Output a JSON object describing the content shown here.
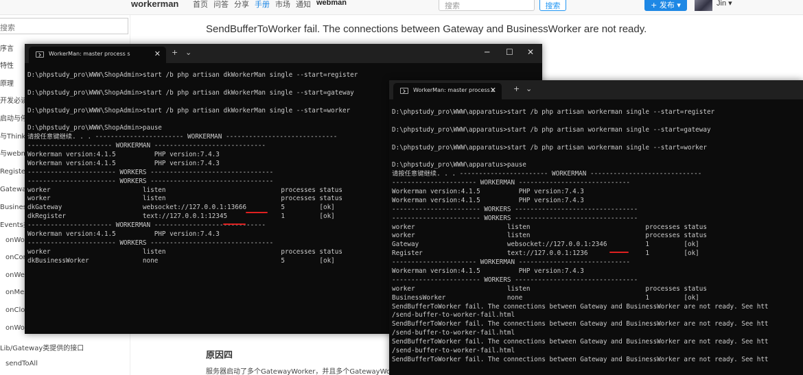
{
  "navbar": {
    "brand": "workerman",
    "links": [
      "首页",
      "问答",
      "分享",
      "手册",
      "市场",
      "通知",
      "webman"
    ],
    "search_placeholder": "搜索",
    "search_button": "搜索",
    "publish_button": "+ 发布 ▾",
    "username": "Jin ▾"
  },
  "sidebar": {
    "search_placeholder": "搜索",
    "items": [
      "序言",
      "特性",
      "原理",
      "开发必读",
      "启动与停止",
      "与ThinkPHP",
      "与webman",
      "Register类",
      "Gateway类",
      "BusinessWorker类",
      "Events类",
      "onWorkerStart",
      "onConnect",
      "onWebSocketConnect",
      "onMessage",
      "onClose",
      "onWorkerStop",
      "Lib/Gateway类提供的接口",
      "sendToAll"
    ]
  },
  "content": {
    "headline": "SendBufferToWorker fail. The connections between Gateway and BusinessWorker are not ready.",
    "sub_heading": "原因四",
    "paragraph": "服务器启动了多个GatewayWorker，并且多个GatewayWorker使用了相同的端口导致冲突，可以用命令 ps aux 查看进程数并测试"
  },
  "terminal_left": {
    "tab_title": "WorkerMan: master process  s",
    "lines": [
      "D:\\phpstudy_pro\\WWW\\ShopAdmin>start /b php artisan dkWorkerMan single --start=register",
      "",
      "D:\\phpstudy_pro\\WWW\\ShopAdmin>start /b php artisan dkWorkerMan single --start=gateway",
      "",
      "D:\\phpstudy_pro\\WWW\\ShopAdmin>start /b php artisan dkWorkerMan single --start=worker",
      "",
      "D:\\phpstudy_pro\\WWW\\ShopAdmin>pause",
      "请按任意键继续. . . ----------------------- WORKERMAN -----------------------------",
      "---------------------- WORKERMAN -----------------------------",
      "Workerman version:4.1.5          PHP version:7.4.3",
      "Workerman version:4.1.5          PHP version:7.4.3",
      "----------------------- WORKERS --------------------------------",
      "----------------------- WORKERS --------------------------------",
      "worker                        listen                              processes status",
      "worker                        listen                              processes status",
      "dkGateway                     websocket://127.0.0.1:13666         5         [ok]",
      "dkRegister                    text://127.0.0.1:12345              1         [ok]",
      "---------------------- WORKERMAN -----------------------------",
      "Workerman version:4.1.5          PHP version:7.4.3",
      "----------------------- WORKERS --------------------------------",
      "worker                        listen                              processes status",
      "dkBusinessWorker              none                                5         [ok]"
    ]
  },
  "terminal_right": {
    "tab_title": "WorkerMan: master process  s",
    "lines": [
      "D:\\phpstudy_pro\\WWW\\apparatus>start /b php artisan workerman single --start=register",
      "",
      "D:\\phpstudy_pro\\WWW\\apparatus>start /b php artisan workerman single --start=gateway",
      "",
      "D:\\phpstudy_pro\\WWW\\apparatus>start /b php artisan workerman single --start=worker",
      "",
      "D:\\phpstudy_pro\\WWW\\apparatus>pause",
      "请按任意键继续. . . ----------------------- WORKERMAN -----------------------------",
      "---------------------- WORKERMAN -----------------------------",
      "Workerman version:4.1.5          PHP version:7.4.3",
      "Workerman version:4.1.5          PHP version:7.4.3",
      "----------------------- WORKERS --------------------------------",
      "----------------------- WORKERS --------------------------------",
      "worker                        listen                              processes status",
      "worker                        listen                              processes status",
      "Gateway                       websocket://127.0.0.1:2346          1         [ok]",
      "Register                      text://127.0.0.1:1236               1         [ok]",
      "---------------------- WORKERMAN -----------------------------",
      "Workerman version:4.1.5          PHP version:7.4.3",
      "----------------------- WORKERS --------------------------------",
      "worker                        listen                              processes status",
      "BusinessWorker                none                                1         [ok]",
      "SendBufferToWorker fail. The connections between Gateway and BusinessWorker are not ready. See htt",
      "/send-buffer-to-worker-fail.html",
      "SendBufferToWorker fail. The connections between Gateway and BusinessWorker are not ready. See htt",
      "/send-buffer-to-worker-fail.html",
      "SendBufferToWorker fail. The connections between Gateway and BusinessWorker are not ready. See htt",
      "/send-buffer-to-worker-fail.html",
      "SendBufferToWorker fail. The connections between Gateway and BusinessWorker are not ready. See htt"
    ]
  },
  "colors": {
    "accent": "#1e88e5",
    "terminal_bg": "#0c0c0c",
    "terminal_fg": "#cccccc",
    "underline": "#e02020"
  },
  "icons": [
    "terminal-icon",
    "close-icon",
    "plus-icon",
    "chevron-down-icon",
    "minimize-icon",
    "maximize-icon"
  ]
}
